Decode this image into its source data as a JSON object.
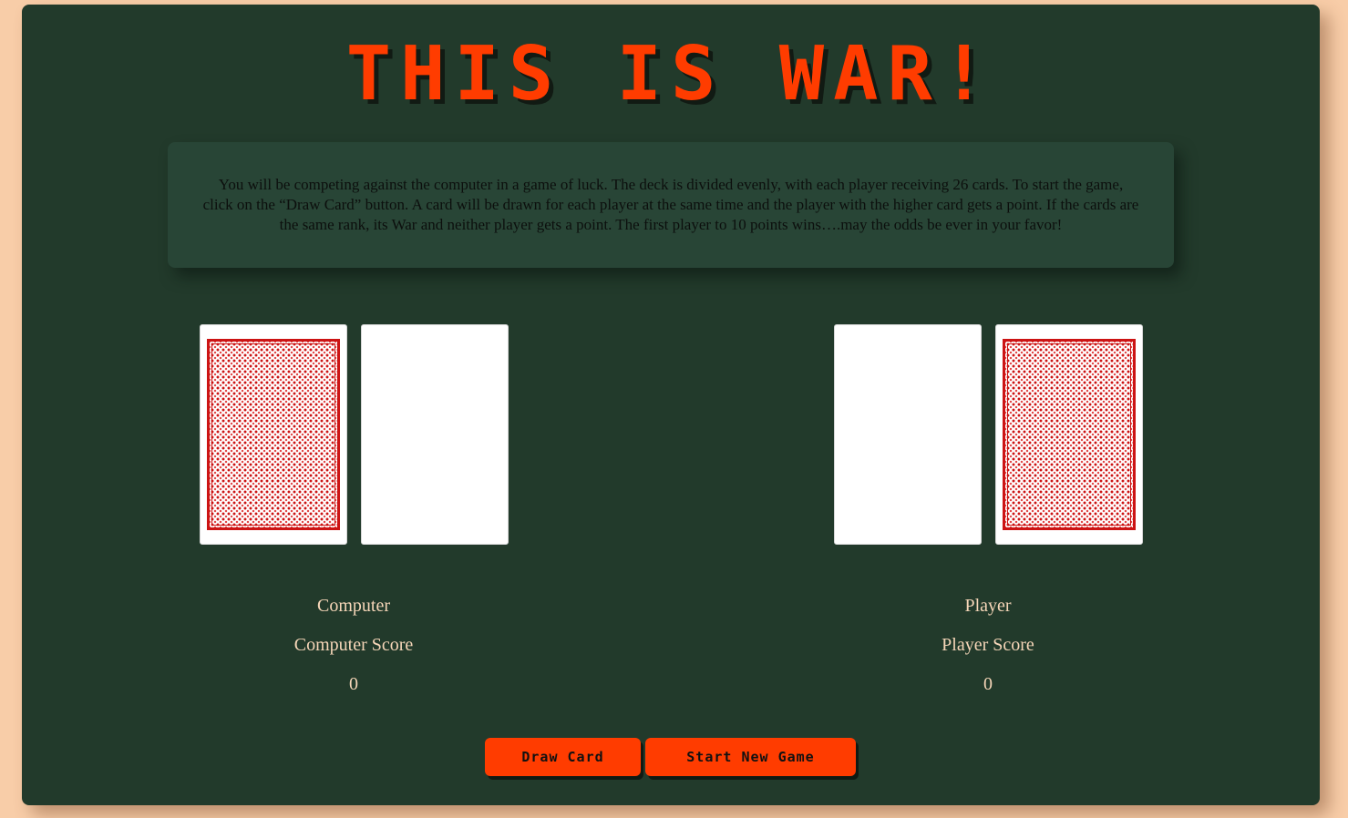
{
  "game": {
    "title": "THIS IS WAR!",
    "instructions": "You will be competing against the computer in a game of luck. The deck is divided evenly, with each player receiving 26 cards. To start the game, click on the “Draw Card” button. A card will be drawn for each player at the same time and the player with the higher card gets a point. If the cards are the same rank, its War and neither player gets a point. The first player to 10 points wins….may the odds be ever in your favor!"
  },
  "computer": {
    "name": "Computer",
    "score_label": "Computer Score",
    "score": "0"
  },
  "player": {
    "name": "Player",
    "score_label": "Player Score",
    "score": "0"
  },
  "controls": {
    "draw_label": "Draw Card",
    "new_game_label": "Start New Game"
  },
  "colors": {
    "background": "#f8cda8",
    "panel": "#223a2b",
    "intro_box": "#284536",
    "accent": "#ff3c00",
    "card_back": "#cc1414",
    "label_text": "#f6d6b8"
  },
  "icons": {
    "deck": "card-back-icon"
  }
}
